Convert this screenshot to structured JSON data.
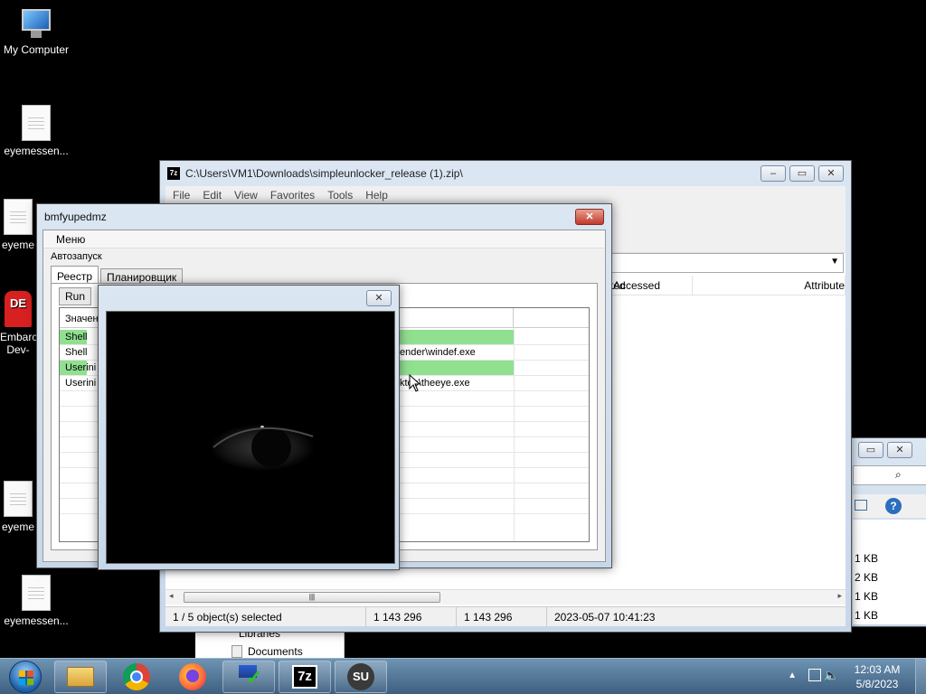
{
  "desktop": {
    "icons": [
      {
        "label": "My Computer"
      },
      {
        "label": "eyemessen..."
      },
      {
        "label": "eyeme"
      },
      {
        "label": "Embarc Dev-"
      },
      {
        "label": "eyeme"
      },
      {
        "label": "eyemessen..."
      }
    ]
  },
  "zip_window": {
    "title": "C:\\Users\\VM1\\Downloads\\simpleunlocker_release (1).zip\\",
    "app_icon": "7z",
    "menu": [
      "File",
      "Edit",
      "View",
      "Favorites",
      "Tools",
      "Help"
    ],
    "columns": [
      "ted",
      "Accessed",
      "Attribute"
    ],
    "status": {
      "selected": "1 / 5 object(s) selected",
      "size": "1 143 296",
      "packed": "1 143 296",
      "modified": "2023-05-07 10:41:23"
    }
  },
  "explorer_window": {
    "sizes": [
      "1 KB",
      "2 KB",
      "1 KB",
      "1 KB"
    ],
    "nav": [
      "Libraries",
      "Documents"
    ]
  },
  "bm_window": {
    "title": "bmfyupedmz",
    "menu": "Меню",
    "section": "Автозапуск",
    "tabs": [
      "Реестр",
      "Планировщик"
    ],
    "subtab": "Run",
    "column_header": "Значен",
    "rows": [
      {
        "name": "Shell",
        "value": "",
        "highlight": true
      },
      {
        "name": "Shell",
        "value": "ender\\windef.exe",
        "highlight": false
      },
      {
        "name": "Userini",
        "value": "",
        "highlight": true
      },
      {
        "name": "Userini",
        "value": "ktop\\theeye.exe",
        "highlight": false
      }
    ],
    "highlight_color": "#90e090"
  },
  "eye_window": {
    "close_icon": "close-icon"
  },
  "taskbar": {
    "apps": [
      "explorer",
      "chrome",
      "firefox",
      "bmfyupedmz",
      "7-zip",
      "simpleunlocker"
    ],
    "app_7z_label": "7z",
    "app_su_label": "SU",
    "clock_time": "12:03 AM",
    "clock_date": "5/8/2023"
  }
}
